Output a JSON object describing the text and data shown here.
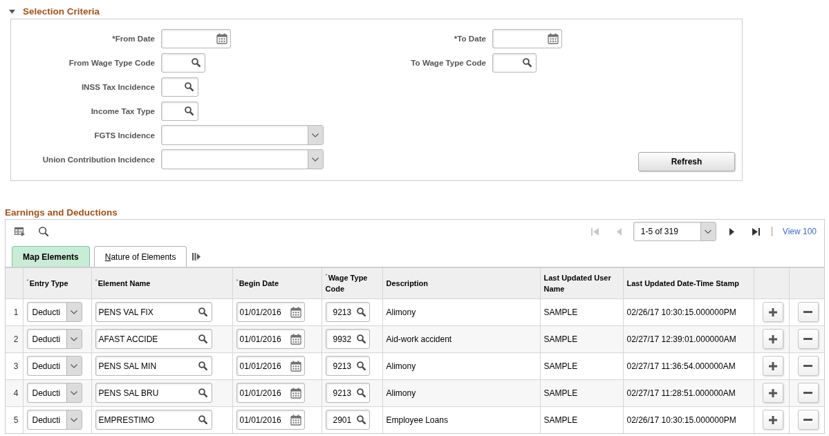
{
  "selection_criteria": {
    "title": "Selection Criteria",
    "expanded": true,
    "left_fields": [
      {
        "label": "*From Date",
        "kind": "date"
      },
      {
        "label": "From Wage Type Code",
        "kind": "lookup"
      },
      {
        "label": "INSS Tax Incidence",
        "kind": "lookup"
      },
      {
        "label": "Income Tax Type",
        "kind": "lookup"
      },
      {
        "label": "FGTS Incidence",
        "kind": "select"
      },
      {
        "label": "Union Contribution Incidence",
        "kind": "select"
      }
    ],
    "right_fields": [
      {
        "label": "*To Date",
        "kind": "date"
      },
      {
        "label": "To Wage Type Code",
        "kind": "lookup"
      }
    ],
    "refresh_button": "Refresh"
  },
  "earnings_and_deductions": {
    "title": "Earnings and Deductions",
    "pagination": {
      "first_disabled": true,
      "previous_disabled": true,
      "range": "1-5 of 319",
      "next_disabled": false,
      "last_disabled": false,
      "view_all_link": "View 100"
    },
    "tabs": [
      {
        "label": "Map Elements",
        "selected": true,
        "access_key_underlined": false
      },
      {
        "label": "Nature of Elements",
        "selected": false,
        "access_key_underlined": true
      }
    ],
    "columns": [
      "$^{*}$Entry Type",
      "$^{*}$Element Name",
      "$^{*}$Begin Date",
      "$^{*}$Wage Type Code",
      "Description",
      "Last Updated User Name",
      "Last Updated Date-Time Stamp"
    ],
    "rows": [
      {
        "number": "1",
        "entry_type": "Deducti",
        "element_name": "PENS VAL FIX",
        "begin_date": "01/01/2016",
        "wage_type_code": "9213",
        "description": "Alimony",
        "user_name": "SAMPLE",
        "timestamp": "02/26/17 10:30:15.000000PM"
      },
      {
        "number": "2",
        "entry_type": "Deducti",
        "element_name": "AFAST ACCIDE",
        "begin_date": "01/01/2016",
        "wage_type_code": "9932",
        "description": "Aid-work accident",
        "user_name": "SAMPLE",
        "timestamp": "02/27/17 12:39:01.000000AM"
      },
      {
        "number": "3",
        "entry_type": "Deducti",
        "element_name": "PENS SAL MIN",
        "begin_date": "01/01/2016",
        "wage_type_code": "9213",
        "description": "Alimony",
        "user_name": "SAMPLE",
        "timestamp": "02/27/17 11:36:54.000000AM"
      },
      {
        "number": "4",
        "entry_type": "Deducti",
        "element_name": "PENS SAL BRU",
        "begin_date": "01/01/2016",
        "wage_type_code": "9213",
        "description": "Alimony",
        "user_name": "SAMPLE",
        "timestamp": "02/27/17 11:28:51.000000AM"
      },
      {
        "number": "5",
        "entry_type": "Deducti",
        "element_name": "EMPRESTIMO",
        "begin_date": "01/01/2016",
        "wage_type_code": "2901",
        "description": "Employee Loans",
        "user_name": "SAMPLE",
        "timestamp": "02/26/17 10:30:15.000000PM"
      }
    ]
  }
}
